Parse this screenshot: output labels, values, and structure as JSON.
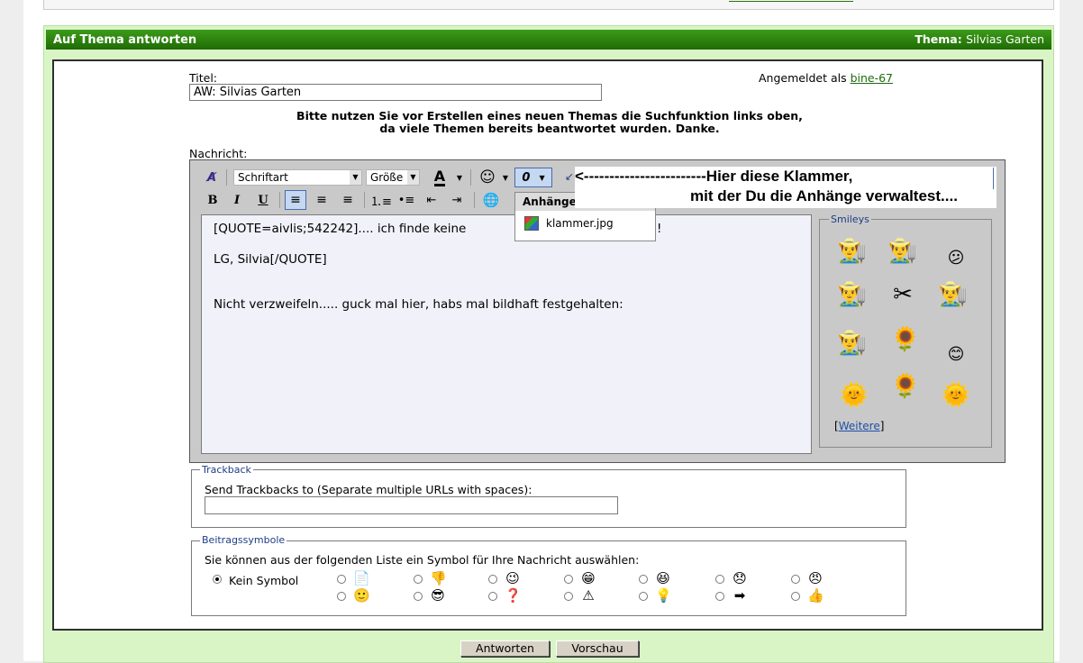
{
  "header": {
    "title": "Auf Thema antworten",
    "thema_label": "Thema",
    "thema_value": "Silvias Garten"
  },
  "form": {
    "title_label": "Titel:",
    "title_value": "AW: Silvias Garten",
    "logged_in_prefix": "Angemeldet als",
    "username": "bine-67",
    "notice_line1": "Bitte nutzen Sie vor Erstellen eines neuen Themas die Suchfunktion links oben,",
    "notice_line2": "da viele Themen bereits beantwortet wurden. Danke.",
    "message_label": "Nachricht:"
  },
  "toolbar": {
    "font_select": "Schriftart",
    "size_select": "Größe",
    "bold": "B",
    "italic": "I",
    "underline": "U"
  },
  "editor": {
    "lines": [
      "[QUOTE=aivlis;542242].... ich finde keine",
      "!",
      "LG, Silvia[/QUOTE]",
      "Nicht verzweifeln..... guck mal hier, habs mal bildhaft festgehalten:"
    ]
  },
  "attachments_menu": {
    "header": "Anhänge verwalten",
    "item": "klammer.jpg"
  },
  "callout": {
    "line1": "<------------------------Hier diese Klammer,",
    "line2": "mit der Du die Anhänge verwaltest...."
  },
  "smileys": {
    "legend": "Smileys",
    "more": "Weitere",
    "items": [
      "gardener-icon",
      "gardener-icon",
      "confused-icon",
      "gardener-icon",
      "pruning-shears-icon",
      "gardener-icon",
      "gardener-icon",
      "sunflower-icon",
      "smile-icon",
      "sun-icon",
      "sunflower-icon",
      "sun-icon"
    ]
  },
  "trackback": {
    "legend": "Trackback",
    "label": "Send Trackbacks to (Separate multiple URLs with spaces):",
    "value": ""
  },
  "post_icons": {
    "legend": "Beitragssymbole",
    "label": "Sie können aus der folgenden Liste ein Symbol für Ihre Nachricht auswählen:",
    "none_label": "Kein Symbol",
    "selected": "Kein Symbol",
    "icons": [
      "document-icon",
      "thumbs-down-icon",
      "wink-icon",
      "grin-icon",
      "laugh-icon",
      "sad-icon",
      "angry-icon",
      "smile-icon",
      "cool-icon",
      "question-icon",
      "warning-icon",
      "lightbulb-icon",
      "arrow-right-icon",
      "thumbs-up-icon"
    ]
  },
  "buttons": {
    "submit": "Antworten",
    "preview": "Vorschau"
  },
  "colors": {
    "header_green": "#2a7f10",
    "panel_bg": "#d9f5c6",
    "editor_bg": "#f1f1fa",
    "link": "#1e6a0d"
  }
}
